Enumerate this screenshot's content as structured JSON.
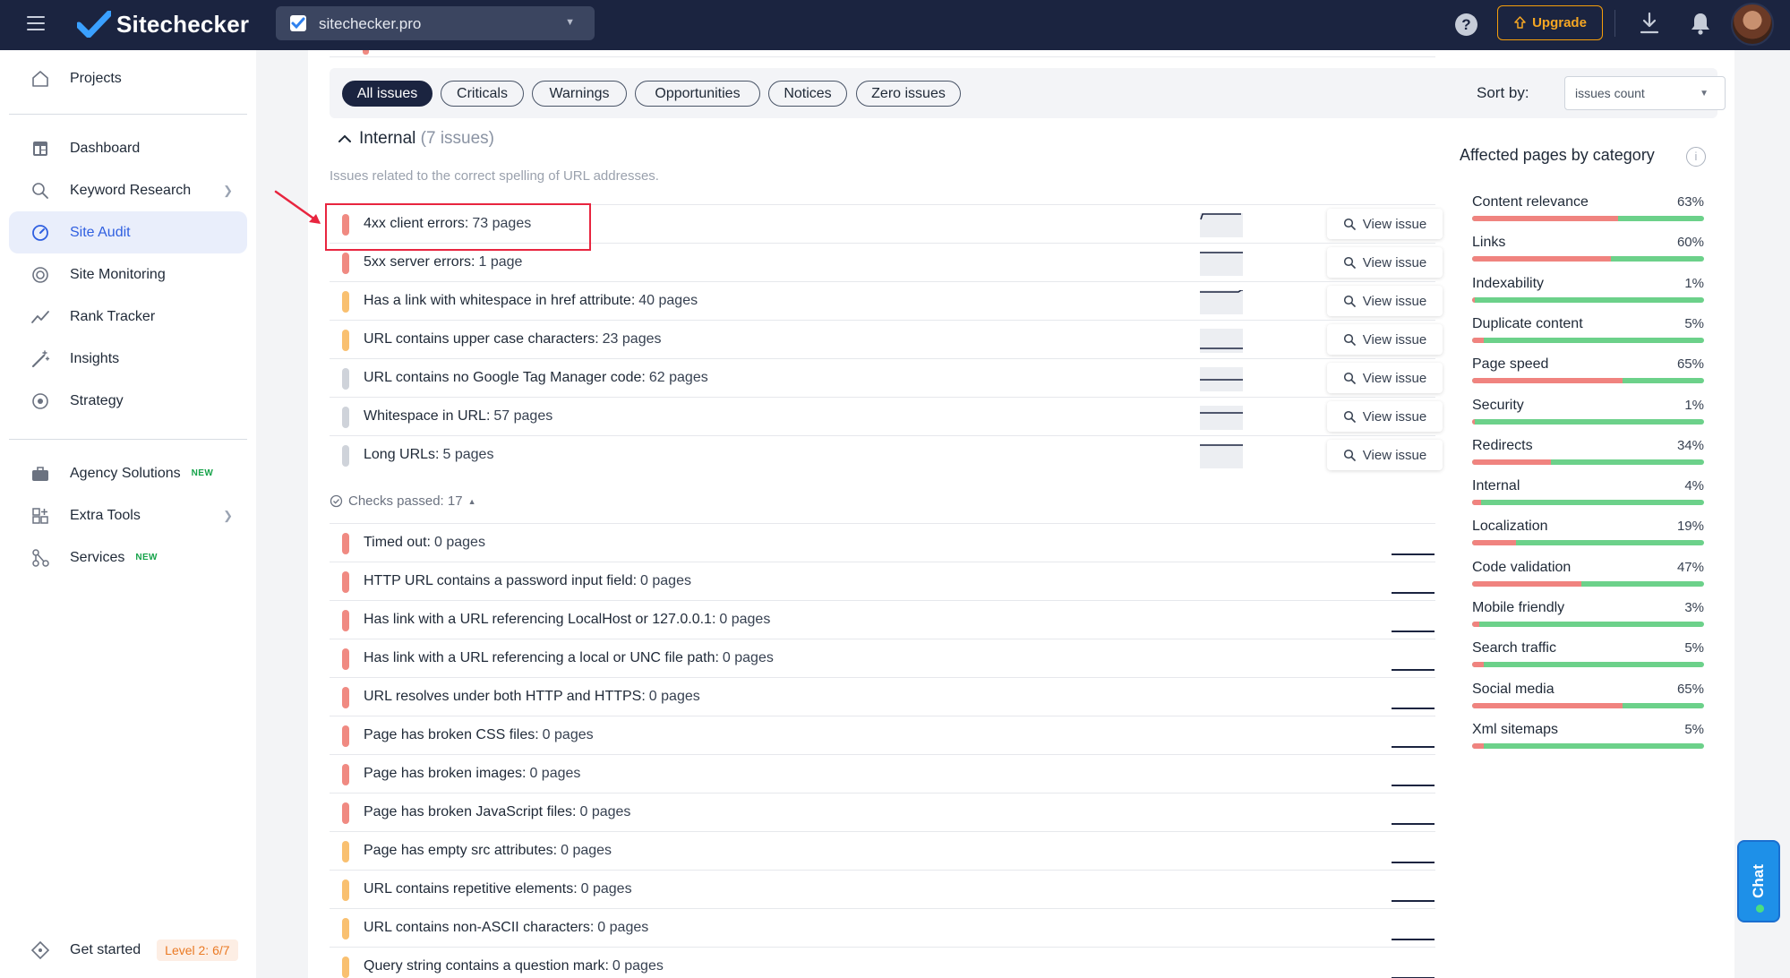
{
  "app": {
    "name": "Sitechecker",
    "project": "sitechecker.pro",
    "upgrade_label": "Upgrade"
  },
  "sidebar": {
    "items": [
      {
        "label": "Projects",
        "icon": "home-icon"
      },
      {
        "label": "Dashboard",
        "icon": "dashboard-icon"
      },
      {
        "label": "Keyword Research",
        "icon": "keyword-search-icon"
      },
      {
        "label": "Site Audit",
        "icon": "site-audit-icon",
        "active": true
      },
      {
        "label": "Site Monitoring",
        "icon": "monitoring-icon"
      },
      {
        "label": "Rank Tracker",
        "icon": "trend-icon"
      },
      {
        "label": "Insights",
        "icon": "magic-wand-icon"
      },
      {
        "label": "Strategy",
        "icon": "target-icon"
      },
      {
        "label": "Agency Solutions",
        "icon": "briefcase-icon",
        "badge": "NEW"
      },
      {
        "label": "Extra Tools",
        "icon": "grid-plus-icon"
      },
      {
        "label": "Services",
        "icon": "nodes-icon",
        "badge": "NEW"
      }
    ],
    "get_started": {
      "label": "Get started",
      "level": "Level 2: 6/7"
    }
  },
  "filters": {
    "chips": [
      "All issues",
      "Criticals",
      "Warnings",
      "Opportunities",
      "Notices",
      "Zero issues"
    ],
    "active": "All issues",
    "sort_label": "Sort by:",
    "sort_value": "issues count"
  },
  "section": {
    "title": "Internal",
    "count": "(7 issues)",
    "description": "Issues related to the correct spelling of URL addresses."
  },
  "issues": [
    {
      "name": "4xx client errors:",
      "pages": "73 pages",
      "severity": "red"
    },
    {
      "name": "5xx server errors:",
      "pages": "1 page",
      "severity": "red"
    },
    {
      "name": "Has a link with whitespace in href attribute:",
      "pages": "40 pages",
      "severity": "orange"
    },
    {
      "name": "URL contains upper case characters:",
      "pages": "23 pages",
      "severity": "orange"
    },
    {
      "name": "URL contains no Google Tag Manager code:",
      "pages": "62 pages",
      "severity": "gray"
    },
    {
      "name": "Whitespace in URL:",
      "pages": "57 pages",
      "severity": "gray"
    },
    {
      "name": "Long URLs:",
      "pages": "5 pages",
      "severity": "gray"
    }
  ],
  "view_issue_label": "View issue",
  "checks_passed": "Checks passed: 17",
  "passed": [
    {
      "name": "Timed out:",
      "pages": "0 pages",
      "severity": "red"
    },
    {
      "name": "HTTP URL contains a password input field:",
      "pages": "0 pages",
      "severity": "red"
    },
    {
      "name": "Has link with a URL referencing LocalHost or 127.0.0.1:",
      "pages": "0 pages",
      "severity": "red"
    },
    {
      "name": "Has link with a URL referencing a local or UNC file path:",
      "pages": "0 pages",
      "severity": "red"
    },
    {
      "name": "URL resolves under both HTTP and HTTPS:",
      "pages": "0 pages",
      "severity": "red"
    },
    {
      "name": "Page has broken CSS files:",
      "pages": "0 pages",
      "severity": "red"
    },
    {
      "name": "Page has broken images:",
      "pages": "0 pages",
      "severity": "red"
    },
    {
      "name": "Page has broken JavaScript files:",
      "pages": "0 pages",
      "severity": "red"
    },
    {
      "name": "Page has empty src attributes:",
      "pages": "0 pages",
      "severity": "orange"
    },
    {
      "name": "URL contains repetitive elements:",
      "pages": "0 pages",
      "severity": "orange"
    },
    {
      "name": "URL contains non-ASCII characters:",
      "pages": "0 pages",
      "severity": "orange"
    },
    {
      "name": "Query string contains a question mark:",
      "pages": "0 pages",
      "severity": "orange"
    }
  ],
  "panel": {
    "title": "Affected pages by category",
    "categories": [
      {
        "name": "Content relevance",
        "pct": "63%",
        "value": 63
      },
      {
        "name": "Links",
        "pct": "60%",
        "value": 60
      },
      {
        "name": "Indexability",
        "pct": "1%",
        "value": 1
      },
      {
        "name": "Duplicate content",
        "pct": "5%",
        "value": 5
      },
      {
        "name": "Page speed",
        "pct": "65%",
        "value": 65
      },
      {
        "name": "Security",
        "pct": "1%",
        "value": 1
      },
      {
        "name": "Redirects",
        "pct": "34%",
        "value": 34
      },
      {
        "name": "Internal",
        "pct": "4%",
        "value": 4
      },
      {
        "name": "Localization",
        "pct": "19%",
        "value": 19
      },
      {
        "name": "Code validation",
        "pct": "47%",
        "value": 47
      },
      {
        "name": "Mobile friendly",
        "pct": "3%",
        "value": 3
      },
      {
        "name": "Search traffic",
        "pct": "5%",
        "value": 5
      },
      {
        "name": "Social media",
        "pct": "65%",
        "value": 65
      },
      {
        "name": "Xml sitemaps",
        "pct": "5%",
        "value": 5
      }
    ]
  },
  "chat_label": "Chat",
  "colors": {
    "navy": "#1b2440",
    "accent_blue": "#2f5fe0",
    "critical": "#f08a82",
    "warning": "#f9c070",
    "notice": "#cfd3da",
    "ok": "#6cd18a",
    "upgrade": "#f59e0b",
    "highlight": "#e8253f"
  }
}
